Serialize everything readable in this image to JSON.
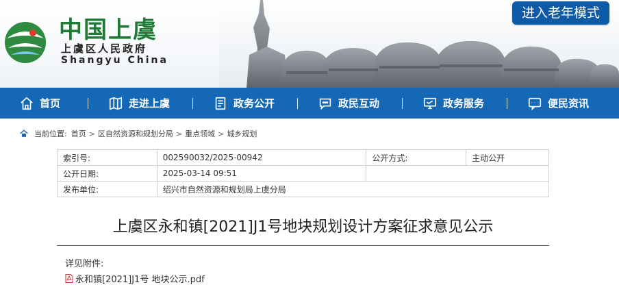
{
  "header": {
    "logo_cn": "中国上虞",
    "logo_sub": "上虞区人民政府",
    "logo_en": "Shangyu China",
    "elder_mode_button": "进入老年模式"
  },
  "nav": {
    "items": [
      {
        "label": "首页",
        "icon": "home-icon"
      },
      {
        "label": "走进上虞",
        "icon": "map-icon"
      },
      {
        "label": "政务公开",
        "icon": "document-icon"
      },
      {
        "label": "政民互动",
        "icon": "chat-icon"
      },
      {
        "label": "政务服务",
        "icon": "monitor-icon"
      },
      {
        "label": "便民资讯",
        "icon": "message-icon"
      }
    ]
  },
  "breadcrumb": {
    "prefix": "当前位置:",
    "items": [
      "首页",
      "区自然资源和规划分局",
      "重点领域",
      "城乡规划"
    ]
  },
  "info": {
    "index_label": "索引号:",
    "index_value": "002590032/2025-00942",
    "mode_label": "公开方式:",
    "mode_value": "主动公开",
    "date_label": "公开日期:",
    "date_value": "2025-03-14 09:51",
    "publisher_label": "发布单位:",
    "publisher_value": "绍兴市自然资源和规划局上虞分局"
  },
  "article": {
    "title": "上虞区永和镇[2021]J1号地块规划设计方案征求意见公示",
    "attachments_label": "详见附件:",
    "attachment_name": "永和镇[2021]J1号 地块公示.pdf"
  },
  "colors": {
    "nav_bg": "#1568b5",
    "elder_button_bg": "#0f5aa6",
    "logo_green": "#1e7a34"
  }
}
